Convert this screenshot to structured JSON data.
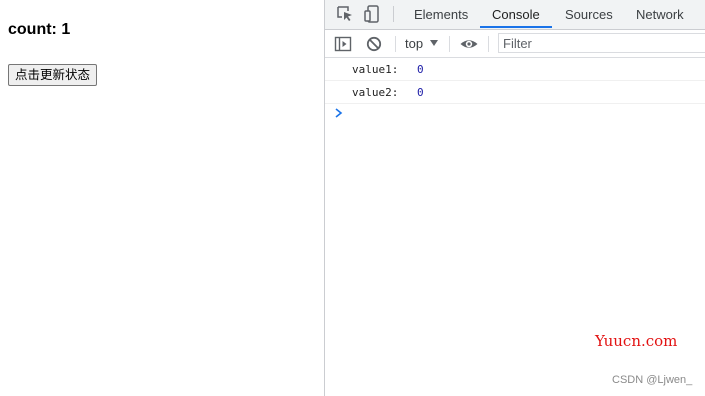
{
  "page": {
    "count_text": "count: 1",
    "button_label": "点击更新状态"
  },
  "devtools": {
    "tabs": [
      {
        "label": "Elements"
      },
      {
        "label": "Console"
      },
      {
        "label": "Sources"
      },
      {
        "label": "Network"
      }
    ],
    "active_tab": "Console",
    "toolbar": {
      "context": "top",
      "filter_placeholder": "Filter"
    },
    "console": {
      "messages": [
        {
          "key": "value1:",
          "value": "0"
        },
        {
          "key": "value2:",
          "value": "0"
        }
      ]
    },
    "accent_color": "#1a73e8"
  },
  "watermarks": {
    "site": "Yuucn.com",
    "author": "CSDN @Ljwen_"
  }
}
